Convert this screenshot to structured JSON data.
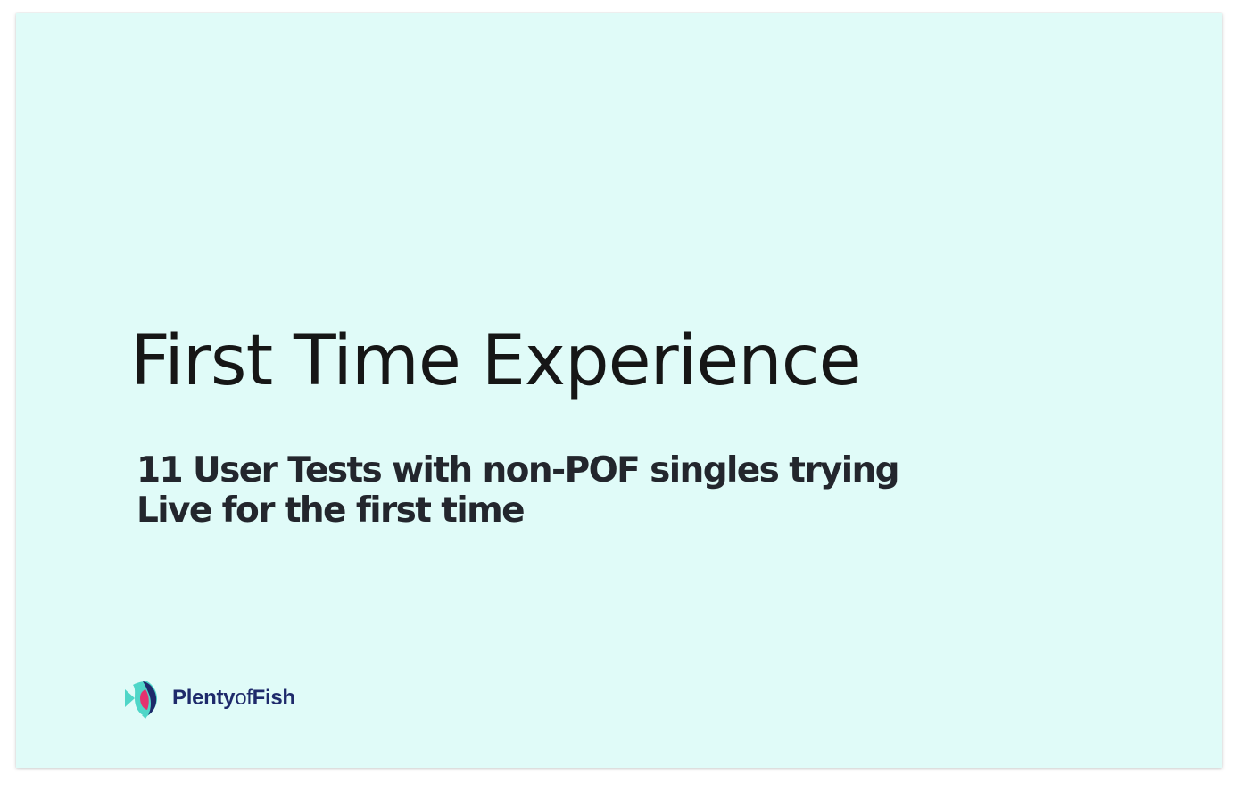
{
  "slide": {
    "title": "First Time Experience",
    "subtitle_lines": [
      "11 User Tests with non-POF singles trying",
      "Live for the first time"
    ],
    "logo": {
      "icon": "plentyoffish-fish-logo-icon",
      "name_part1": "Plenty",
      "name_part2": "of",
      "name_part3": "Fish"
    }
  },
  "colors": {
    "background": "#e0fbf8",
    "title": "#161616",
    "subtitle": "#23262d",
    "brand_navy": "#1e2a6b",
    "brand_pink": "#e5316f",
    "brand_teal": "#4fd6c8"
  }
}
